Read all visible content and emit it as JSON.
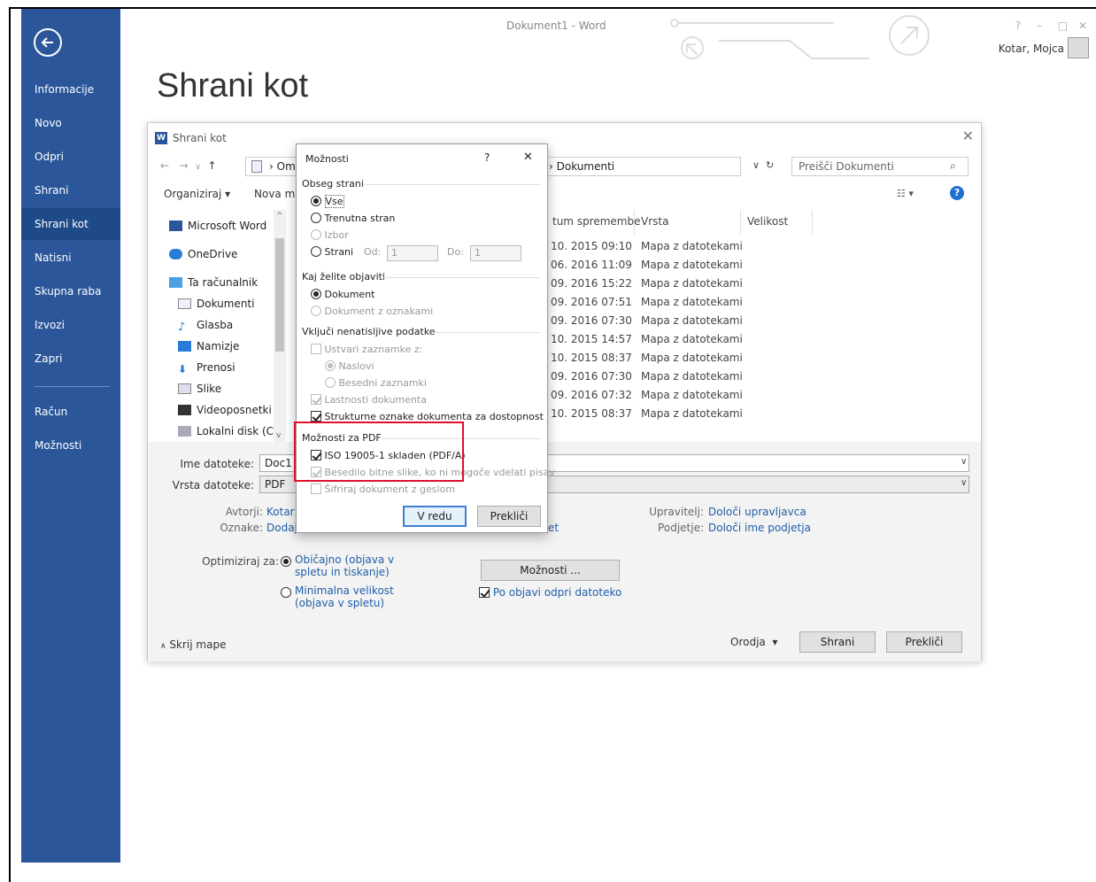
{
  "window": {
    "title": "Dokument1 - Word",
    "user": "Kotar, Mojca",
    "help": "?",
    "minimize": "–",
    "restore": "□",
    "close": "✕"
  },
  "page_title": "Shrani kot",
  "sidebar": {
    "items": [
      {
        "label": "Informacije"
      },
      {
        "label": "Novo"
      },
      {
        "label": "Odpri"
      },
      {
        "label": "Shrani"
      },
      {
        "label": "Shrani kot"
      },
      {
        "label": "Natisni"
      },
      {
        "label": "Skupna raba"
      },
      {
        "label": "Izvozi"
      },
      {
        "label": "Zapri"
      },
      {
        "label": "Račun"
      },
      {
        "label": "Možnosti"
      }
    ]
  },
  "save_dialog": {
    "title": "Shrani kot",
    "address_part": "Om",
    "address_folder": "Dokumenti",
    "search_placeholder": "Preišči Dokumenti",
    "organize": "Organiziraj",
    "new_folder": "Nova ma",
    "tree": [
      "Microsoft Word",
      "OneDrive",
      "Ta računalnik",
      "Dokumenti",
      "Glasba",
      "Namizje",
      "Prenosi",
      "Slike",
      "Videoposnetki",
      "Lokalni disk (C:)"
    ],
    "columns": {
      "date": "tum spremembe",
      "type": "Vrsta",
      "size": "Velikost"
    },
    "rows": [
      {
        "date": "10. 2015 09:10",
        "type": "Mapa z datotekami"
      },
      {
        "date": "06. 2016 11:09",
        "type": "Mapa z datotekami"
      },
      {
        "date": "09. 2016 15:22",
        "type": "Mapa z datotekami"
      },
      {
        "date": "09. 2016 07:51",
        "type": "Mapa z datotekami"
      },
      {
        "date": "09. 2016 07:30",
        "type": "Mapa z datotekami"
      },
      {
        "date": "10. 2015 14:57",
        "type": "Mapa z datotekami"
      },
      {
        "date": "10. 2015 08:37",
        "type": "Mapa z datotekami"
      },
      {
        "date": "09. 2016 07:30",
        "type": "Mapa z datotekami"
      },
      {
        "date": "09. 2016 07:32",
        "type": "Mapa z datotekami"
      },
      {
        "date": "10. 2015 08:37",
        "type": "Mapa z datotekami"
      }
    ],
    "filename_label": "Ime datoteke:",
    "filename_value": "Doc1",
    "filetype_label": "Vrsta datoteke:",
    "filetype_value": "PDF",
    "authors_label": "Avtorji:",
    "authors_value": "Kotar,",
    "tags_label": "Oznake:",
    "tags_value": "Dodaj",
    "title_link_fragment": "et",
    "manager_label": "Upravitelj:",
    "manager_value": "Določi upravljavca",
    "company_label": "Podjetje:",
    "company_value": "Določi ime podjetja",
    "optimize_label": "Optimiziraj za:",
    "optimize_standard": "Običajno (objava v spletu in tiskanje)",
    "optimize_minimal": "Minimalna velikost (objava v spletu)",
    "options_button": "Možnosti ...",
    "open_after": "Po objavi odpri datoteko",
    "hide_folders": "Skrij mape",
    "tools": "Orodja",
    "save": "Shrani",
    "cancel": "Prekliči"
  },
  "options_dialog": {
    "title": "Možnosti",
    "help": "?",
    "close": "✕",
    "range_section": "Obseg strani",
    "range_all": "Vse",
    "range_current": "Trenutna stran",
    "range_selection": "Izbor",
    "range_pages": "Strani",
    "from_label": "Od:",
    "from_value": "1",
    "to_label": "Do:",
    "to_value": "1",
    "publish_section": "Kaj želite objaviti",
    "publish_document": "Dokument",
    "publish_markup": "Dokument z oznakami",
    "include_section": "Vključi nenatisljive podatke",
    "create_bookmarks": "Ustvari zaznamke z:",
    "bm_headings": "Naslovi",
    "bm_word": "Besedni zaznamki",
    "doc_properties": "Lastnosti dokumenta",
    "struct_tags": "Strukturne oznake dokumenta za dostopnost",
    "pdf_section": "Možnosti za PDF",
    "iso": "ISO 19005-1 skladen (PDF/A)",
    "bitmap_text": "Besedilo bitne slike, ko ni mogoče vdelati pisav",
    "encrypt": "Šifriraj dokument z geslom",
    "ok": "V redu",
    "cancel": "Prekliči"
  }
}
